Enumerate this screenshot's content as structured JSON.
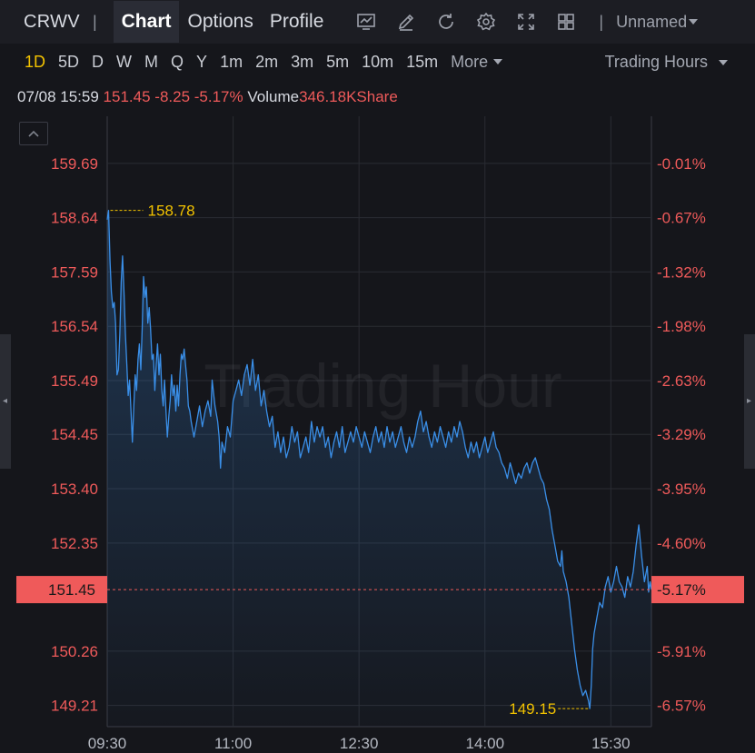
{
  "header": {
    "ticker": "CRWV",
    "separator": "|",
    "tabs": [
      {
        "label": "Chart",
        "active": true
      },
      {
        "label": "Options",
        "active": false
      },
      {
        "label": "Profile",
        "active": false
      }
    ],
    "tool_icons": [
      "chart-indicator-icon",
      "pencil-icon",
      "refresh-icon",
      "settings-gear-icon",
      "fullscreen-icon",
      "grid-layout-icon"
    ],
    "layout_name": "Unnamed"
  },
  "periods": {
    "items": [
      "1D",
      "5D",
      "D",
      "W",
      "M",
      "Q",
      "Y",
      "1m",
      "2m",
      "3m",
      "5m",
      "10m",
      "15m"
    ],
    "selected": "1D",
    "more_label": "More",
    "session_label": "Trading Hours"
  },
  "quote": {
    "datetime": "07/08 15:59",
    "price": "151.45",
    "change": "-8.25",
    "change_pct": "-5.17%",
    "volume_label": "Volume",
    "volume_value": "346.18KShare"
  },
  "colors": {
    "background": "#15161b",
    "line": "#3a8fe8",
    "down": "#ef5a5a",
    "highlight": "#f2c200",
    "grid": "#2a2c33"
  },
  "chart_data": {
    "type": "line",
    "watermark": "Trading Hour",
    "x_ticks": [
      "09:30",
      "11:00",
      "12:30",
      "14:00",
      "15:30"
    ],
    "x_tick_minutes": [
      0,
      90,
      180,
      270,
      360
    ],
    "x_range_minutes": [
      0,
      389
    ],
    "y_range": [
      148.8,
      160.6
    ],
    "y_ticks_left": [
      "159.69",
      "158.64",
      "157.59",
      "156.54",
      "155.49",
      "154.45",
      "153.40",
      "152.35",
      "151.45",
      "150.26",
      "149.21"
    ],
    "y_ticks_right": [
      "-0.01%",
      "-0.67%",
      "-1.32%",
      "-1.98%",
      "-2.63%",
      "-3.29%",
      "-3.95%",
      "-4.60%",
      "-5.17%",
      "-5.91%",
      "-6.57%"
    ],
    "y_tick_values": [
      159.69,
      158.64,
      157.59,
      156.54,
      155.49,
      154.45,
      153.4,
      152.35,
      151.45,
      150.26,
      149.21
    ],
    "last_price": 151.45,
    "last_price_label": "151.45",
    "last_pct_label": "-5.17%",
    "high": {
      "value": 158.78,
      "label": "158.78",
      "minute": 1
    },
    "low": {
      "value": 149.15,
      "label": "149.15",
      "minute": 345
    },
    "series": [
      {
        "points": [
          [
            0,
            158.6
          ],
          [
            1,
            158.78
          ],
          [
            2,
            157.8
          ],
          [
            3,
            157.2
          ],
          [
            4,
            156.9
          ],
          [
            5,
            157.0
          ],
          [
            6,
            156.6
          ],
          [
            7,
            155.6
          ],
          [
            8,
            155.7
          ],
          [
            9,
            156.4
          ],
          [
            10,
            157.4
          ],
          [
            11,
            157.9
          ],
          [
            12,
            157.2
          ],
          [
            13,
            156.4
          ],
          [
            14,
            155.8
          ],
          [
            15,
            155.2
          ],
          [
            16,
            155.5
          ],
          [
            17,
            154.9
          ],
          [
            18,
            154.3
          ],
          [
            19,
            155.0
          ],
          [
            20,
            155.6
          ],
          [
            21,
            155.3
          ],
          [
            22,
            155.9
          ],
          [
            23,
            156.2
          ],
          [
            24,
            155.7
          ],
          [
            25,
            156.5
          ],
          [
            26,
            157.5
          ],
          [
            27,
            157.1
          ],
          [
            28,
            157.3
          ],
          [
            29,
            156.6
          ],
          [
            30,
            156.9
          ],
          [
            31,
            156.5
          ],
          [
            32,
            155.9
          ],
          [
            33,
            156.0
          ],
          [
            34,
            155.3
          ],
          [
            35,
            155.8
          ],
          [
            36,
            156.2
          ],
          [
            37,
            155.6
          ],
          [
            38,
            156.0
          ],
          [
            39,
            155.3
          ],
          [
            40,
            155.0
          ],
          [
            41,
            155.5
          ],
          [
            42,
            154.9
          ],
          [
            43,
            154.4
          ],
          [
            44,
            154.8
          ],
          [
            45,
            155.1
          ],
          [
            46,
            155.6
          ],
          [
            47,
            155.2
          ],
          [
            48,
            155.4
          ],
          [
            49,
            154.9
          ],
          [
            50,
            155.4
          ],
          [
            51,
            155.0
          ],
          [
            52,
            155.6
          ],
          [
            53,
            156.0
          ],
          [
            54,
            155.9
          ],
          [
            55,
            156.1
          ],
          [
            56,
            155.8
          ],
          [
            57,
            155.5
          ],
          [
            58,
            155.0
          ],
          [
            59,
            154.9
          ],
          [
            60,
            154.7
          ],
          [
            62,
            154.4
          ],
          [
            64,
            154.7
          ],
          [
            66,
            155.0
          ],
          [
            68,
            154.6
          ],
          [
            70,
            154.9
          ],
          [
            72,
            155.1
          ],
          [
            74,
            154.8
          ],
          [
            75,
            155.5
          ],
          [
            77,
            155.0
          ],
          [
            79,
            154.7
          ],
          [
            80,
            154.4
          ],
          [
            81,
            153.8
          ],
          [
            82,
            154.3
          ],
          [
            84,
            154.1
          ],
          [
            86,
            154.6
          ],
          [
            88,
            154.4
          ],
          [
            90,
            155.1
          ],
          [
            92,
            155.3
          ],
          [
            94,
            155.5
          ],
          [
            96,
            155.2
          ],
          [
            98,
            155.6
          ],
          [
            100,
            155.8
          ],
          [
            102,
            155.4
          ],
          [
            104,
            155.9
          ],
          [
            106,
            155.3
          ],
          [
            108,
            155.6
          ],
          [
            110,
            155.0
          ],
          [
            112,
            155.3
          ],
          [
            114,
            154.9
          ],
          [
            116,
            154.6
          ],
          [
            118,
            154.8
          ],
          [
            120,
            154.2
          ],
          [
            122,
            154.5
          ],
          [
            124,
            154.1
          ],
          [
            126,
            154.4
          ],
          [
            128,
            154.0
          ],
          [
            130,
            154.2
          ],
          [
            132,
            154.6
          ],
          [
            134,
            154.3
          ],
          [
            136,
            154.5
          ],
          [
            138,
            154.0
          ],
          [
            140,
            154.2
          ],
          [
            142,
            154.4
          ],
          [
            144,
            154.1
          ],
          [
            146,
            154.7
          ],
          [
            148,
            154.3
          ],
          [
            150,
            154.6
          ],
          [
            152,
            154.4
          ],
          [
            154,
            154.6
          ],
          [
            156,
            154.2
          ],
          [
            158,
            154.4
          ],
          [
            160,
            154.0
          ],
          [
            162,
            154.3
          ],
          [
            164,
            154.5
          ],
          [
            166,
            154.2
          ],
          [
            168,
            154.6
          ],
          [
            170,
            154.1
          ],
          [
            172,
            154.3
          ],
          [
            174,
            154.5
          ],
          [
            176,
            154.3
          ],
          [
            178,
            154.6
          ],
          [
            180,
            154.4
          ],
          [
            182,
            154.2
          ],
          [
            184,
            154.5
          ],
          [
            186,
            154.3
          ],
          [
            188,
            154.1
          ],
          [
            190,
            154.4
          ],
          [
            192,
            154.6
          ],
          [
            194,
            154.3
          ],
          [
            196,
            154.5
          ],
          [
            198,
            154.2
          ],
          [
            200,
            154.6
          ],
          [
            202,
            154.3
          ],
          [
            204,
            154.5
          ],
          [
            206,
            154.2
          ],
          [
            208,
            154.4
          ],
          [
            210,
            154.6
          ],
          [
            212,
            154.3
          ],
          [
            214,
            154.1
          ],
          [
            216,
            154.4
          ],
          [
            218,
            154.2
          ],
          [
            220,
            154.4
          ],
          [
            222,
            154.7
          ],
          [
            224,
            154.9
          ],
          [
            226,
            154.5
          ],
          [
            228,
            154.7
          ],
          [
            230,
            154.4
          ],
          [
            232,
            154.2
          ],
          [
            234,
            154.5
          ],
          [
            236,
            154.3
          ],
          [
            238,
            154.6
          ],
          [
            240,
            154.4
          ],
          [
            242,
            154.2
          ],
          [
            244,
            154.5
          ],
          [
            246,
            154.3
          ],
          [
            248,
            154.6
          ],
          [
            250,
            154.4
          ],
          [
            252,
            154.7
          ],
          [
            254,
            154.5
          ],
          [
            256,
            154.2
          ],
          [
            258,
            154.0
          ],
          [
            260,
            154.3
          ],
          [
            262,
            154.1
          ],
          [
            264,
            154.3
          ],
          [
            266,
            154.0
          ],
          [
            268,
            154.2
          ],
          [
            270,
            154.4
          ],
          [
            272,
            154.1
          ],
          [
            274,
            154.3
          ],
          [
            276,
            154.5
          ],
          [
            278,
            154.2
          ],
          [
            280,
            154.1
          ],
          [
            282,
            153.9
          ],
          [
            284,
            153.8
          ],
          [
            286,
            153.6
          ],
          [
            288,
            153.9
          ],
          [
            290,
            153.7
          ],
          [
            292,
            153.5
          ],
          [
            294,
            153.7
          ],
          [
            296,
            153.6
          ],
          [
            298,
            153.8
          ],
          [
            300,
            153.9
          ],
          [
            302,
            153.7
          ],
          [
            304,
            153.9
          ],
          [
            306,
            154.0
          ],
          [
            308,
            153.8
          ],
          [
            310,
            153.6
          ],
          [
            312,
            153.5
          ],
          [
            314,
            153.2
          ],
          [
            316,
            153.0
          ],
          [
            318,
            152.6
          ],
          [
            320,
            152.3
          ],
          [
            322,
            152.0
          ],
          [
            324,
            151.9
          ],
          [
            325,
            152.2
          ],
          [
            326,
            151.8
          ],
          [
            328,
            151.6
          ],
          [
            330,
            151.3
          ],
          [
            332,
            150.8
          ],
          [
            334,
            150.3
          ],
          [
            336,
            149.9
          ],
          [
            338,
            149.6
          ],
          [
            340,
            149.4
          ],
          [
            342,
            149.5
          ],
          [
            344,
            149.3
          ],
          [
            345,
            149.15
          ],
          [
            346,
            149.6
          ],
          [
            347,
            150.3
          ],
          [
            348,
            150.6
          ],
          [
            350,
            150.9
          ],
          [
            352,
            151.2
          ],
          [
            354,
            151.1
          ],
          [
            356,
            151.5
          ],
          [
            358,
            151.7
          ],
          [
            360,
            151.4
          ],
          [
            362,
            151.6
          ],
          [
            364,
            151.9
          ],
          [
            366,
            151.6
          ],
          [
            368,
            151.5
          ],
          [
            370,
            151.3
          ],
          [
            372,
            151.7
          ],
          [
            374,
            151.5
          ],
          [
            376,
            151.8
          ],
          [
            378,
            152.3
          ],
          [
            380,
            152.7
          ],
          [
            382,
            152.1
          ],
          [
            384,
            151.6
          ],
          [
            386,
            151.9
          ],
          [
            387,
            151.4
          ],
          [
            388,
            151.6
          ],
          [
            389,
            151.45
          ]
        ]
      }
    ]
  }
}
